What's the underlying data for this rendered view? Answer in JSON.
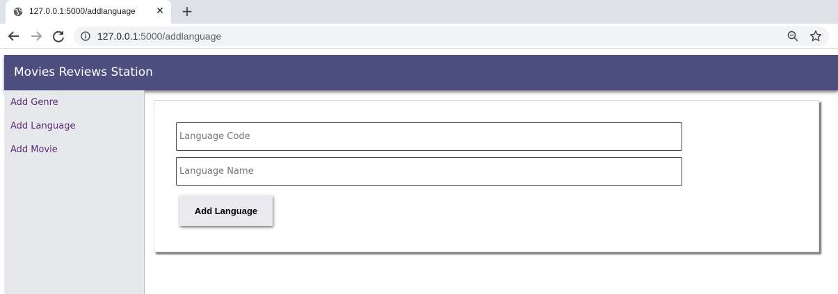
{
  "browser": {
    "tab_title": "127.0.0.1:5000/addlanguage",
    "url_host": "127.0.0.1",
    "url_path": ":5000/addlanguage",
    "icons": {
      "tab": "globe-icon",
      "close": "close-icon",
      "new_tab": "plus-icon",
      "back": "back-arrow-icon",
      "forward": "forward-arrow-icon",
      "reload": "reload-icon",
      "info": "info-icon",
      "zoom": "zoom-out-icon",
      "bookmark": "star-icon"
    }
  },
  "app": {
    "brand": "Movies Reviews Station",
    "colors": {
      "navbar": "#4d4e80",
      "sidebar": "#e7e8ec",
      "link": "#5b2c7a"
    }
  },
  "sidebar": {
    "items": [
      {
        "label": "Add Genre"
      },
      {
        "label": "Add Language"
      },
      {
        "label": "Add Movie"
      }
    ]
  },
  "form": {
    "code_field": {
      "placeholder": "Language Code",
      "value": ""
    },
    "name_field": {
      "placeholder": "Language Name",
      "value": ""
    },
    "submit_label": "Add Language"
  }
}
